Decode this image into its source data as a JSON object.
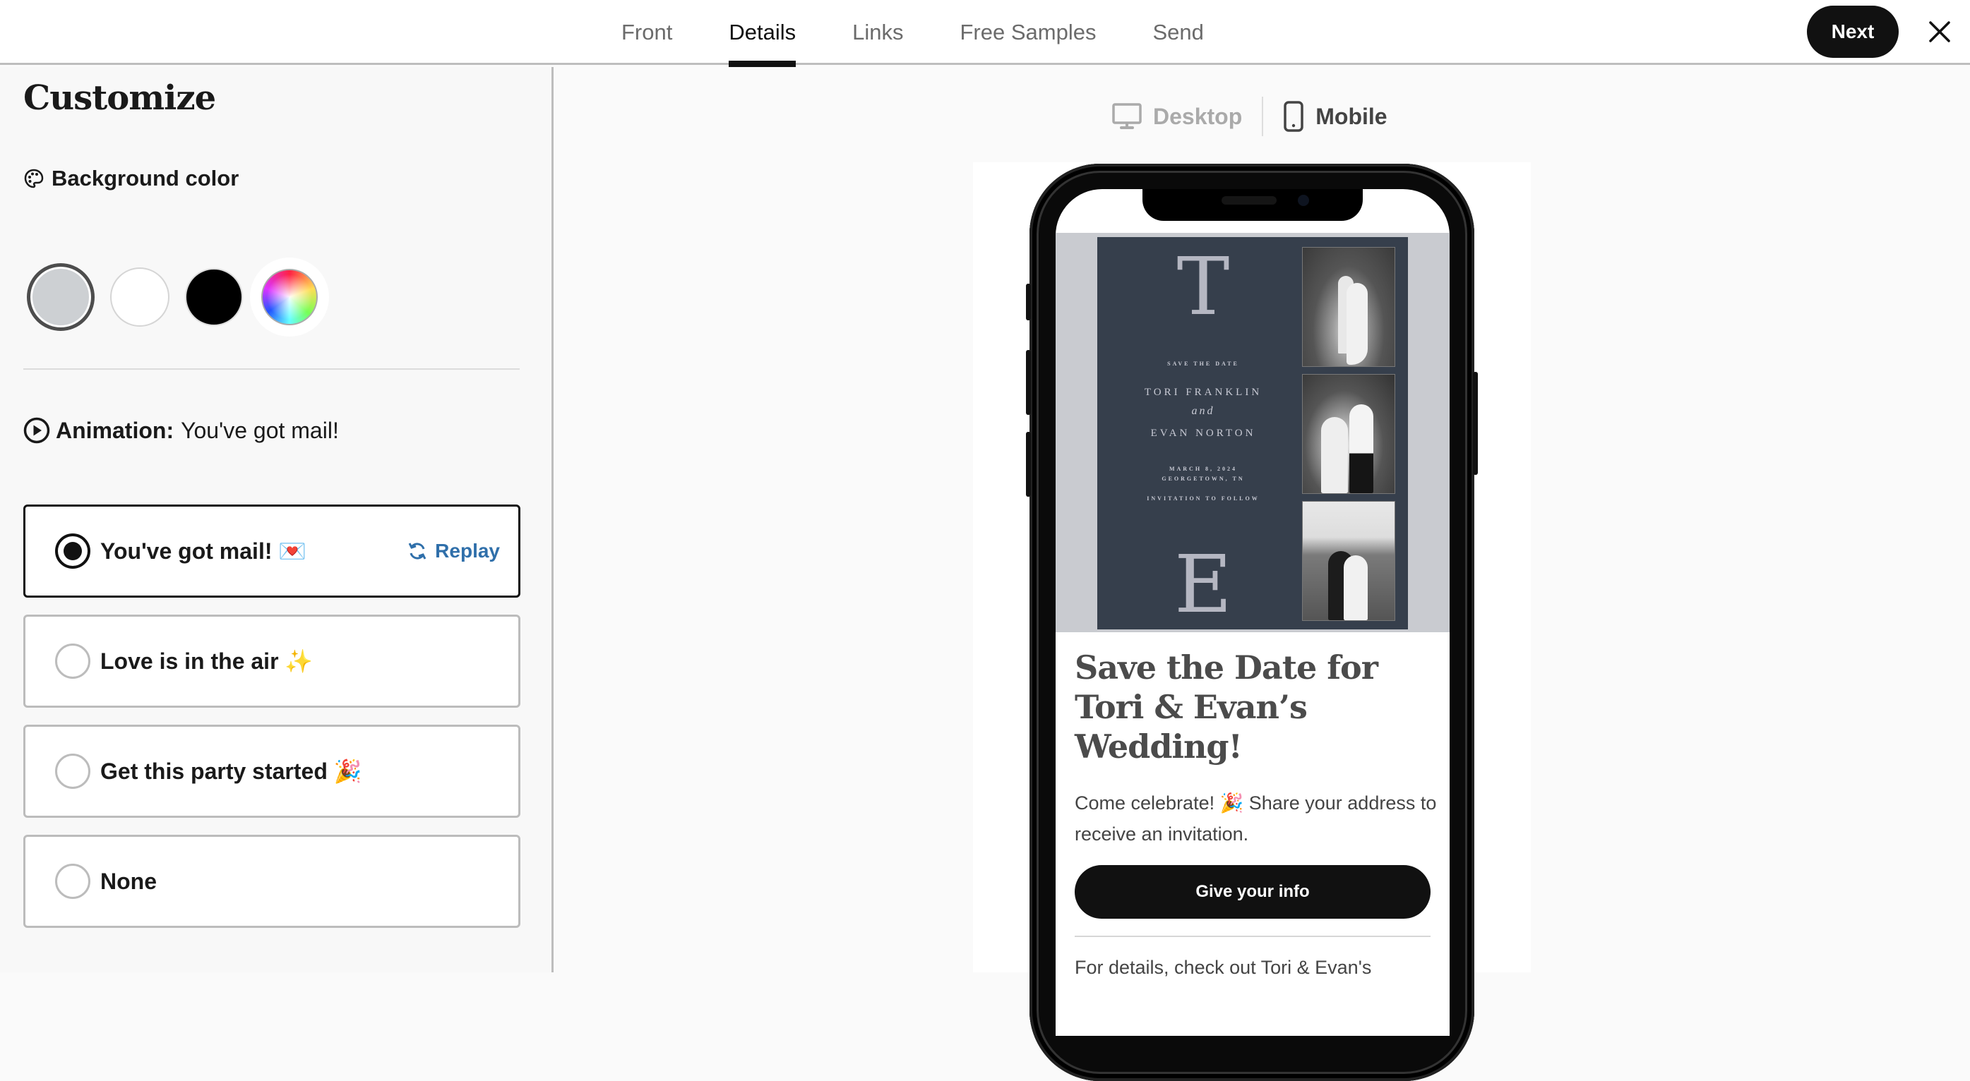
{
  "header": {
    "tabs": [
      {
        "label": "Front",
        "active": false
      },
      {
        "label": "Details",
        "active": true
      },
      {
        "label": "Links",
        "active": false
      },
      {
        "label": "Free Samples",
        "active": false
      },
      {
        "label": "Send",
        "active": false
      }
    ],
    "next_label": "Next",
    "close_icon": "close-icon"
  },
  "customize": {
    "title": "Customize",
    "background": {
      "label": "Background color",
      "icon": "palette-icon",
      "swatches": [
        {
          "name": "gray",
          "color": "#cdd0d3",
          "selected": true
        },
        {
          "name": "white",
          "color": "#ffffff",
          "selected": false
        },
        {
          "name": "black",
          "color": "#000000",
          "selected": false
        },
        {
          "name": "custom",
          "color": "rainbow",
          "selected": false
        }
      ]
    },
    "animation": {
      "label": "Animation:",
      "current": "You've got mail!",
      "icon": "play-circle-icon",
      "replay_label": "Replay",
      "options": [
        {
          "label": "You've got mail! 💌",
          "selected": true
        },
        {
          "label": "Love is in the air ✨",
          "selected": false
        },
        {
          "label": "Get this party started 🎉",
          "selected": false
        },
        {
          "label": "None",
          "selected": false
        }
      ]
    }
  },
  "preview": {
    "desktop_label": "Desktop",
    "mobile_label": "Mobile",
    "active_view": "Mobile",
    "card": {
      "monogram_top": "T",
      "monogram_bottom": "E",
      "save_the_date": "SAVE THE DATE",
      "name1": "TORI FRANKLIN",
      "and": "and",
      "name2": "EVAN NORTON",
      "date": "MARCH 8, 2024",
      "location": "GEORGETOWN, TN",
      "follow": "INVITATION TO FOLLOW",
      "card_color": "#363f4c"
    },
    "heading": "Save the Date for Tori & Evan’s Wedding!",
    "body": "Come celebrate! 🎉 Share your address to receive an invitation.",
    "cta_label": "Give your info",
    "footer": "For details, check out Tori & Evan's"
  }
}
